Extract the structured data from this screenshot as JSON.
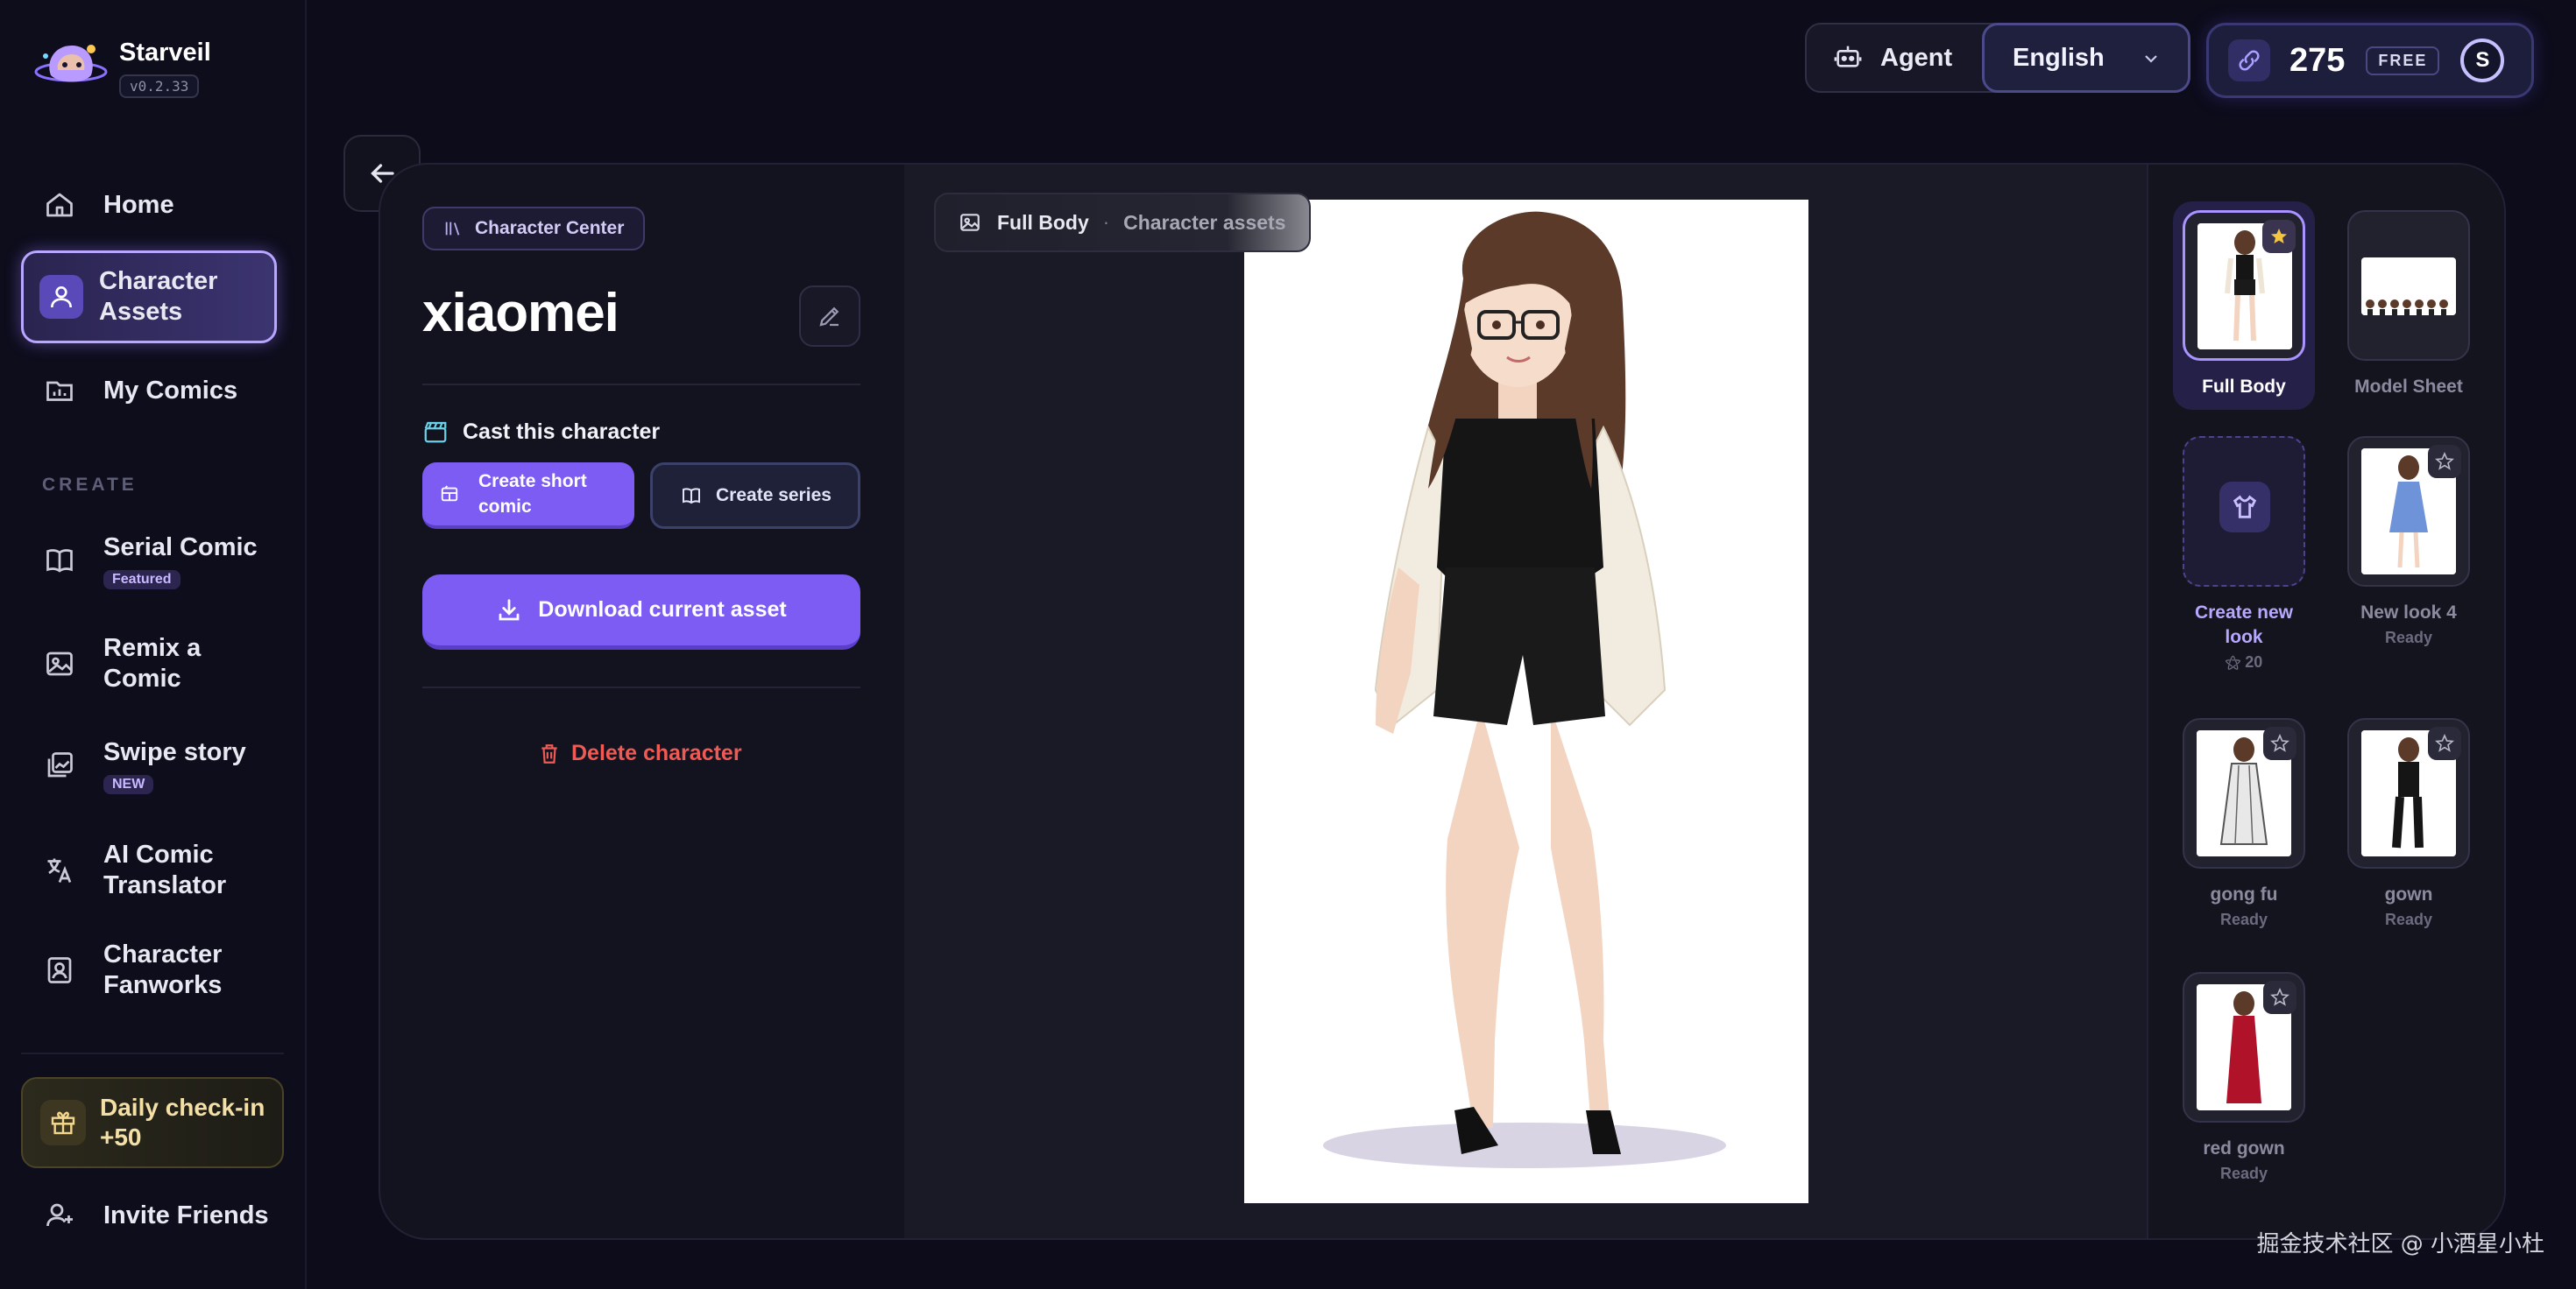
{
  "brand": {
    "name": "Starveil",
    "version": "v0.2.33"
  },
  "nav": {
    "home": "Home",
    "character_assets": "Character Assets",
    "my_comics": "My Comics",
    "section_create": "CREATE",
    "serial_comic": "Serial Comic",
    "serial_comic_badge": "Featured",
    "remix": "Remix a Comic",
    "swipe_story": "Swipe story",
    "swipe_story_badge": "NEW",
    "translator": "AI Comic Translator",
    "fanworks": "Character Fanworks",
    "daily_checkin": "Daily check-in +50",
    "invite": "Invite Friends"
  },
  "topbar": {
    "agent": "Agent",
    "language": "English",
    "credits": "275",
    "plan": "FREE",
    "avatar_initial": "S"
  },
  "detail": {
    "breadcrumb": "Character Center",
    "name": "xiaomei",
    "cast_label": "Cast this character",
    "create_short": "Create short comic",
    "create_series": "Create series",
    "download": "Download current asset",
    "delete": "Delete character"
  },
  "viewer": {
    "asset_type": "Full Body",
    "asset_group": "Character assets",
    "dot": "·"
  },
  "gallery": {
    "full_body": {
      "label": "Full Body"
    },
    "model_sheet": {
      "label": "Model Sheet"
    },
    "create_new": {
      "label": "Create new look",
      "cost": "20"
    },
    "new_look_4": {
      "label": "New look 4",
      "status": "Ready"
    },
    "gong_fu": {
      "label": "gong fu",
      "status": "Ready"
    },
    "gown": {
      "label": "gown",
      "status": "Ready"
    },
    "red_gown": {
      "label": "red gown",
      "status": "Ready"
    }
  },
  "watermark": "掘金技术社区 @ 小酒星小杜",
  "colors": {
    "accent": "#7c5cf2",
    "danger": "#ef5a55",
    "background": "#0c0c1b",
    "panel": "#13131f"
  }
}
